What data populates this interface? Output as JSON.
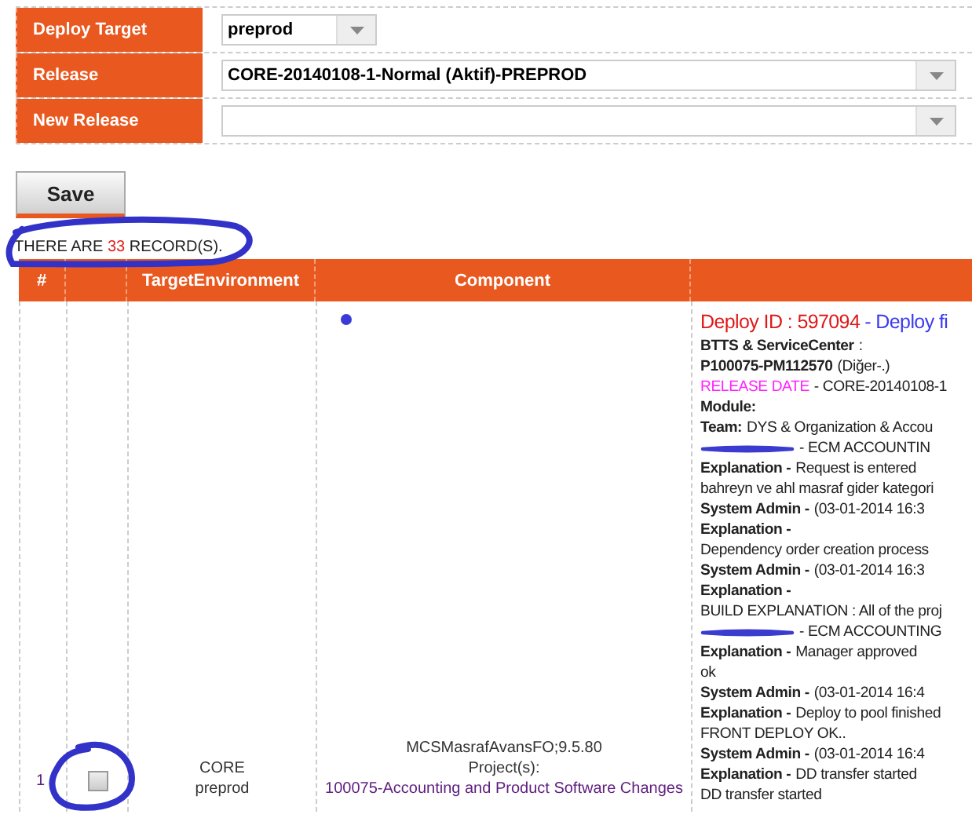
{
  "form": {
    "fields": [
      {
        "label": "Deploy Target",
        "kind": "short-select",
        "value": "preprod"
      },
      {
        "label": "Release",
        "kind": "select",
        "value": "CORE-20140108-1-Normal (Aktif)-PREPROD"
      },
      {
        "label": "New Release",
        "kind": "select"
      }
    ],
    "save_button": "Save"
  },
  "record_count": {
    "prefix": "THERE ARE",
    "count": "33",
    "suffix": "RECORD(S)."
  },
  "table": {
    "columns": [
      "#",
      "",
      "TargetEnvironment",
      "Component",
      ""
    ],
    "rows": [
      {
        "number": "1",
        "checked": false,
        "target": [
          "CORE",
          "preprod"
        ],
        "component": {
          "name": "MCSMasrafAvansFO;9.5.80",
          "projects_label": "Project(s):",
          "project": "100075-Accounting and Product Software Changes"
        },
        "details": [
          {
            "kind": "deploy-id",
            "id": "Deploy ID : 597094",
            "link": "- Deploy fi"
          },
          {
            "kind": "text",
            "text": "**BTTS & ServiceCenter** :"
          },
          {
            "kind": "text",
            "text": "**P100075-PM112570** (Diğer-.)"
          },
          {
            "kind": "release",
            "label": "RELEASE DATE",
            "value": "- CORE-20140108-1"
          },
          {
            "kind": "text",
            "text": "**Module:**"
          },
          {
            "kind": "text",
            "text": "**Team:**DYS & Organization & Accou"
          },
          {
            "kind": "redacted",
            "text": "- ECM ACCOUNTIN"
          },
          {
            "kind": "text",
            "text": "**Explanation -**Request is entered"
          },
          {
            "kind": "text",
            "text": "bahreyn ve ahl masraf gider kategori"
          },
          {
            "kind": "text",
            "text": "**System Admin -**  (03-01-2014 16:3"
          },
          {
            "kind": "text",
            "text": "**Explanation -**"
          },
          {
            "kind": "text",
            "text": "Dependency order creation process"
          },
          {
            "kind": "text",
            "text": "**System Admin -**  (03-01-2014 16:3"
          },
          {
            "kind": "text",
            "text": "**Explanation -**"
          },
          {
            "kind": "text",
            "text": "BUILD EXPLANATION : All of the proj"
          },
          {
            "kind": "redacted",
            "text": "- ECM ACCOUNTING"
          },
          {
            "kind": "text",
            "text": "**Explanation -**Manager approved"
          },
          {
            "kind": "text",
            "text": "ok"
          },
          {
            "kind": "text",
            "text": "**System Admin -**  (03-01-2014 16:4"
          },
          {
            "kind": "text",
            "text": "**Explanation -**Deploy to pool finished"
          },
          {
            "kind": "text",
            "text": "FRONT DEPLOY OK.."
          },
          {
            "kind": "text",
            "text": "**System Admin -**  (03-01-2014 16:4"
          },
          {
            "kind": "text",
            "text": "**Explanation -**DD transfer started"
          },
          {
            "kind": "text",
            "text": "DD transfer started"
          }
        ]
      }
    ]
  }
}
